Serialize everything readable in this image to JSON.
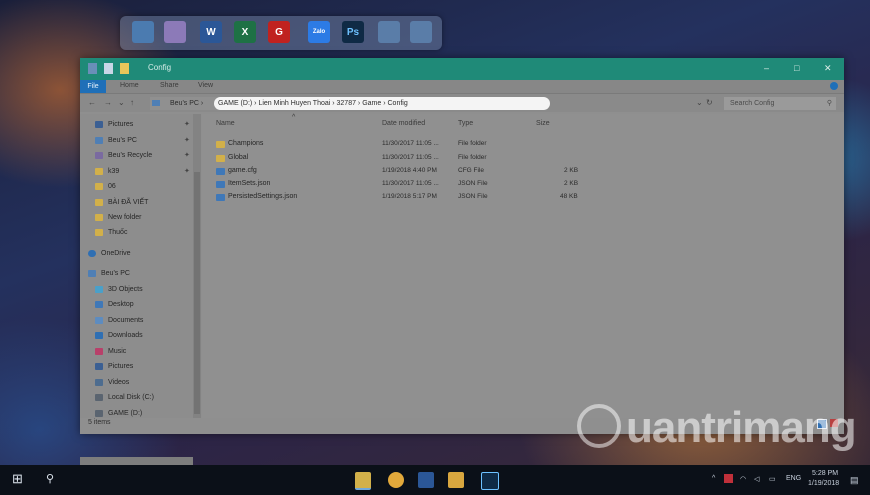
{
  "window": {
    "title": "Config",
    "ribbon_tabs": [
      "File",
      "Home",
      "Share",
      "View"
    ],
    "minimize": "–",
    "maximize": "□",
    "close": "✕"
  },
  "address": {
    "pre_crumbs": "Beu's PC ›",
    "crumbs": "GAME (D:)  ›  Lien Minh Huyen Thoai  ›  32787  ›  Game  ›  Config",
    "search_placeholder": "Search Config"
  },
  "nav": {
    "items": [
      {
        "label": "Pictures",
        "pinned": true,
        "color": "#3b5f93"
      },
      {
        "label": "Beu's PC",
        "pinned": true,
        "color": "#4f7fb5"
      },
      {
        "label": "Beu's Recycle",
        "pinned": true,
        "color": "#7a6aa0"
      },
      {
        "label": "k39",
        "pinned": true,
        "color": "#d2b04a"
      },
      {
        "label": "06",
        "pinned": false,
        "color": "#d2b04a"
      },
      {
        "label": "BÀI ĐÃ VIẾT",
        "pinned": false,
        "color": "#d2b04a"
      },
      {
        "label": "New folder",
        "pinned": false,
        "color": "#d2b04a"
      },
      {
        "label": "Thuốc",
        "pinned": false,
        "color": "#d2b04a"
      },
      {
        "label": "OneDrive",
        "pinned": false,
        "color": "#2f6fb3"
      },
      {
        "label": "Beu's PC",
        "pinned": false,
        "color": "#4f7fb5"
      },
      {
        "label": "3D Objects",
        "pinned": false,
        "color": "#4aa0c9"
      },
      {
        "label": "Desktop",
        "pinned": false,
        "color": "#3f78b8"
      },
      {
        "label": "Documents",
        "pinned": false,
        "color": "#5d8cc0"
      },
      {
        "label": "Downloads",
        "pinned": false,
        "color": "#2f6fb3"
      },
      {
        "label": "Music",
        "pinned": false,
        "color": "#b8406a"
      },
      {
        "label": "Pictures",
        "pinned": false,
        "color": "#3b5f93"
      },
      {
        "label": "Videos",
        "pinned": false,
        "color": "#4d6c8f"
      },
      {
        "label": "Local Disk (C:)",
        "pinned": false,
        "color": "#5a6470"
      },
      {
        "label": "GAME (D:)",
        "pinned": false,
        "color": "#5a6470"
      }
    ]
  },
  "columns": {
    "name": "Name",
    "date": "Date modified",
    "type": "Type",
    "size": "Size"
  },
  "files": [
    {
      "name": "Champions",
      "date": "11/30/2017 11:05 ...",
      "type": "File folder",
      "size": "",
      "color": "#d2b04a"
    },
    {
      "name": "Global",
      "date": "11/30/2017 11:05 ...",
      "type": "File folder",
      "size": "",
      "color": "#d2b04a"
    },
    {
      "name": "game.cfg",
      "date": "1/19/2018 4:40 PM",
      "type": "CFG File",
      "size": "2 KB",
      "color": "#3f78b8"
    },
    {
      "name": "ItemSets.json",
      "date": "11/30/2017 11:05 ...",
      "type": "JSON File",
      "size": "2 KB",
      "color": "#3f78b8"
    },
    {
      "name": "PersistedSettings.json",
      "date": "1/19/2018 5:17 PM",
      "type": "JSON File",
      "size": "48 KB",
      "color": "#3f78b8"
    }
  ],
  "status": {
    "items": "5 items"
  },
  "taskbar": {
    "lang": "ENG",
    "time": "5:28 PM",
    "date": "1/19/2018"
  },
  "watermark": {
    "text": "uantrimang"
  },
  "dock": {
    "icons": [
      {
        "name": "monitor-icon",
        "color": "#4b7bb0",
        "label": ""
      },
      {
        "name": "recycle-bin-icon",
        "color": "#8c7ab8",
        "label": ""
      },
      {
        "name": "word-icon",
        "color": "#2b5797",
        "label": "W"
      },
      {
        "name": "excel-icon",
        "color": "#1e7145",
        "label": "X"
      },
      {
        "name": "garena-icon",
        "color": "#c0221f",
        "label": "G"
      },
      {
        "name": "zalo-icon",
        "color": "#2c7be5",
        "label": "Zalo"
      },
      {
        "name": "photoshop-icon",
        "color": "#0f2a45",
        "label": "Ps"
      },
      {
        "name": "book-icon",
        "color": "#5a7da8",
        "label": ""
      },
      {
        "name": "book2-icon",
        "color": "#5a7da8",
        "label": ""
      }
    ]
  }
}
